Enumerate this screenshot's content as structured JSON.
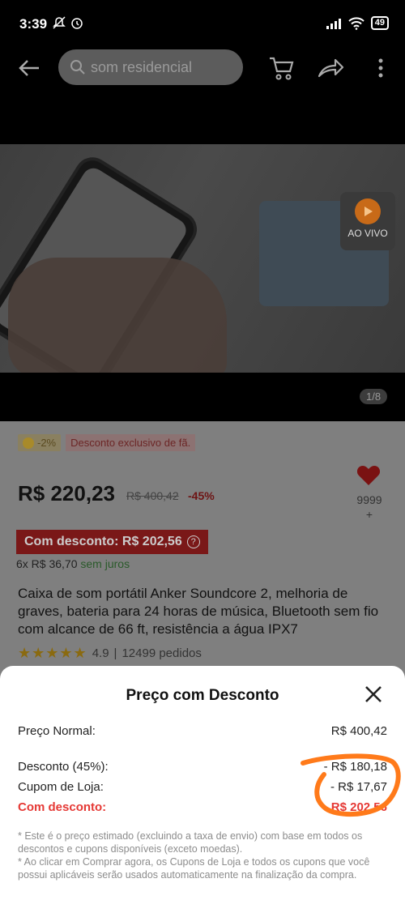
{
  "status_bar": {
    "time": "3:39",
    "battery": "49"
  },
  "app_bar": {
    "search_placeholder": "som residencial"
  },
  "hero": {
    "live_label": "AO VIVO",
    "image_counter": "1/8"
  },
  "product": {
    "coin_discount": "-2%",
    "fan_label": "Desconto exclusivo de fã.",
    "price": "R$ 220,23",
    "old_price": "R$ 400,42",
    "discount_pct": "-45%",
    "wishlist_count": "9999",
    "wishlist_plus": "+",
    "discounted_banner": "Com desconto: R$ 202,56",
    "installments": "6x R$ 36,70",
    "installments_note": "sem juros",
    "title": "Caixa de som portátil Anker Soundcore 2, melhoria de graves, bateria para 24 horas de música, Bluetooth sem fio com alcance de 66 ft, resistência a água IPX7",
    "rating": "4.9",
    "orders": "12499 pedidos"
  },
  "sheet": {
    "title": "Preço com Desconto",
    "rows": [
      {
        "label": "Preço Normal:",
        "value": "R$ 400,42"
      },
      {
        "label": "Desconto (45%):",
        "value": "- R$ 180,18"
      },
      {
        "label": "Cupom de Loja:",
        "value": "- R$ 17,67"
      },
      {
        "label": "Com desconto:",
        "value": "R$ 202,56"
      }
    ],
    "note1": "* Este é o preço estimado (excluindo a taxa de envio) com base em todos os descontos e cupons disponíveis (exceto moedas).",
    "note2": "* Ao clicar em Comprar agora, os Cupons de Loja e todos os cupons que você possui aplicáveis serão usados automaticamente na finalização da compra."
  },
  "colors": {
    "accent_red": "#e53935",
    "annotation_orange": "#ff7a1a"
  }
}
